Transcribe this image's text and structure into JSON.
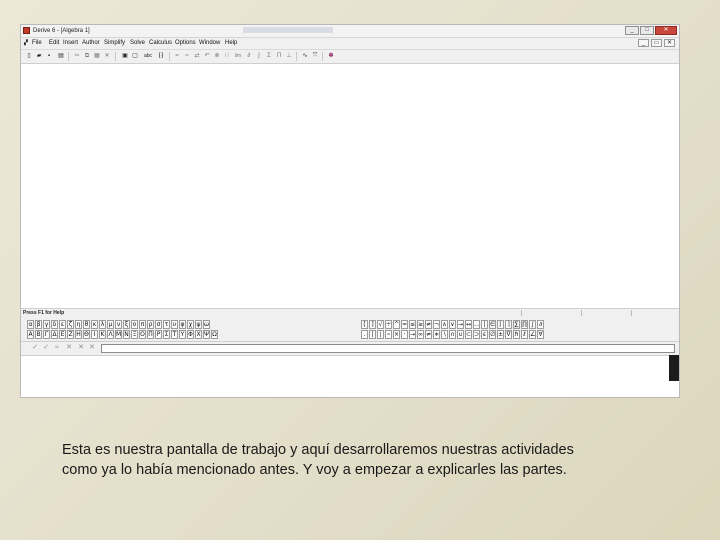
{
  "window": {
    "title": "Derive 6 - [Algebra 1]",
    "controls": {
      "minimize": "_",
      "maximize": "□",
      "close": "✕"
    }
  },
  "menu": {
    "items": [
      "File",
      "Edit",
      "Insert",
      "Author",
      "Simplify",
      "Solve",
      "Calculus",
      "Options",
      "Window",
      "Help"
    ],
    "doc_controls": {
      "minimize": "_",
      "restore": "▭",
      "close": "✕"
    }
  },
  "toolbar": {
    "icons": [
      {
        "name": "new-file-icon",
        "glyph": "▯"
      },
      {
        "name": "open-folder-icon",
        "glyph": "▰"
      },
      {
        "name": "save-icon",
        "glyph": "▪"
      },
      {
        "name": "print-icon",
        "glyph": "▤"
      },
      {
        "name": "cut-icon",
        "glyph": "✂"
      },
      {
        "name": "copy-icon",
        "glyph": "⧉"
      },
      {
        "name": "paste-icon",
        "glyph": "▦"
      },
      {
        "name": "delete-icon",
        "glyph": "✕"
      },
      {
        "name": "window-2d-icon",
        "glyph": "▣"
      },
      {
        "name": "window-3d-icon",
        "glyph": "▢"
      },
      {
        "name": "text-object-icon",
        "glyph": "abc"
      },
      {
        "name": "matrix-icon",
        "glyph": "⁅⁆"
      },
      {
        "name": "equals-icon",
        "glyph": "="
      },
      {
        "name": "approx-icon",
        "glyph": "≈"
      },
      {
        "name": "rewrite-icon",
        "glyph": "⇄"
      },
      {
        "name": "substitute-icon",
        "glyph": "↶"
      },
      {
        "name": "factor-icon",
        "glyph": "⊗"
      },
      {
        "name": "solve-icon",
        "glyph": "∷"
      },
      {
        "name": "limit-icon",
        "glyph": "lim"
      },
      {
        "name": "derivative-icon",
        "glyph": "∂"
      },
      {
        "name": "integral-icon",
        "glyph": "∫"
      },
      {
        "name": "sum-icon",
        "glyph": "Σ"
      },
      {
        "name": "product-icon",
        "glyph": "Π"
      },
      {
        "name": "taylor-icon",
        "glyph": "⊥"
      },
      {
        "name": "plot-2d-icon",
        "glyph": "∿"
      },
      {
        "name": "plot-3d-icon",
        "glyph": "⤧"
      },
      {
        "name": "help-icon",
        "glyph": "✽"
      }
    ]
  },
  "status": {
    "text": "Press F1 for Help"
  },
  "greek_palette": {
    "row1": [
      "α",
      "β",
      "γ",
      "δ",
      "ε",
      "ζ",
      "η",
      "θ",
      "κ",
      "λ",
      "μ",
      "ν",
      "ξ",
      "ο",
      "π",
      "ρ",
      "σ",
      "τ",
      "υ",
      "φ",
      "χ",
      "ψ",
      "ω"
    ],
    "row2": [
      "Α",
      "Β",
      "Γ",
      "Δ",
      "Ε",
      "Ζ",
      "Η",
      "Θ",
      "Ι",
      "Κ",
      "Λ",
      "Μ",
      "Ν",
      "Ξ",
      "Ο",
      "Π",
      "Ρ",
      "Σ",
      "Τ",
      "Υ",
      "Φ",
      "Χ",
      "Ψ",
      "Ω"
    ]
  },
  "math_palette": {
    "row1": [
      "[",
      "]",
      "√",
      "÷",
      "^",
      "≈",
      "≤",
      "≥",
      "≠",
      "¬",
      "∧",
      "∨",
      "→",
      "↔",
      "…",
      "|",
      "∈",
      "⌈",
      "⌉",
      "∑",
      "∏",
      "∫",
      "∂"
    ],
    "row2": [
      ".",
      "|",
      "∣",
      "∘",
      "×",
      "·",
      "→",
      "∞",
      "≠",
      "∗",
      "∖",
      "∩",
      "∪",
      "⊂",
      "⊃",
      "ε",
      "∅",
      "±",
      "∇",
      "ℏ",
      "ℓ",
      "∠",
      "∀"
    ]
  },
  "input_bar": {
    "icons": [
      {
        "name": "enter-expression-icon",
        "glyph": "✓"
      },
      {
        "name": "enter-simplify-icon",
        "glyph": "✓"
      },
      {
        "name": "enter-approximate-icon",
        "glyph": "≈"
      },
      {
        "name": "clear-input-icon",
        "glyph": "✕"
      },
      {
        "name": "enter-solve-icon",
        "glyph": "✕"
      },
      {
        "name": "cancel-input-icon",
        "glyph": "✕"
      }
    ],
    "value": ""
  },
  "caption": {
    "line1": "Esta es nuestra pantalla de trabajo y aquí desarrollaremos nuestras actividades",
    "line2": "como ya lo había mencionado antes. Y voy a empezar a explicarles las partes."
  }
}
